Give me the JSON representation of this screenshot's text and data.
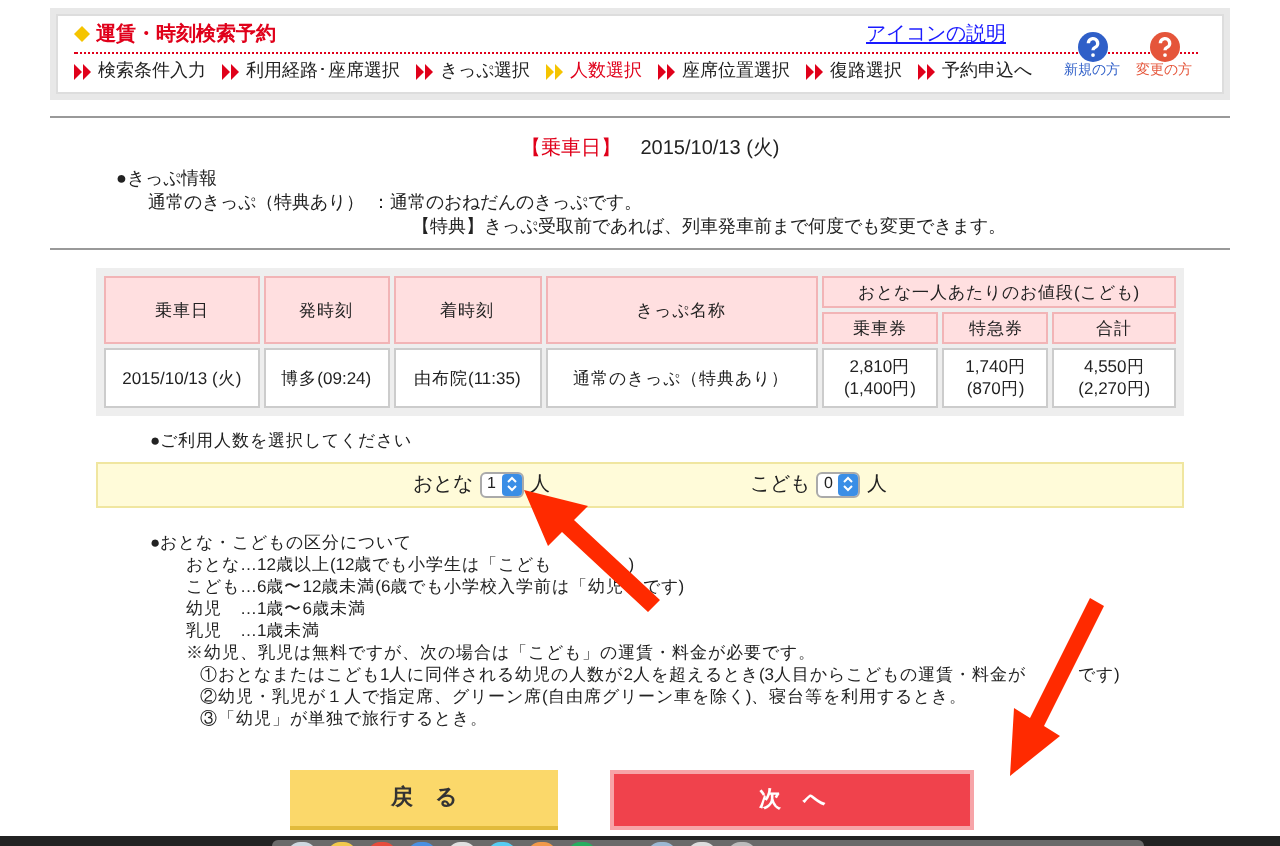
{
  "header": {
    "title": "運賃・時刻検索予約",
    "help_link": "アイコンの説明",
    "help_icons": [
      {
        "label": "新規の方",
        "color": "#2f5fc8"
      },
      {
        "label": "変更の方",
        "color": "#e5553a"
      }
    ],
    "steps": [
      {
        "label": "検索条件入力",
        "selected": false
      },
      {
        "label": "利用経路･座席選択",
        "selected": false
      },
      {
        "label": "きっぷ選択",
        "selected": false
      },
      {
        "label": "人数選択",
        "selected": true
      },
      {
        "label": "座席位置選択",
        "selected": false
      },
      {
        "label": "復路選択",
        "selected": false
      },
      {
        "label": "予約申込へ",
        "selected": false
      }
    ]
  },
  "ride_date": {
    "label": "【乗車日】",
    "value": "2015/10/13 (火)"
  },
  "ticket_info": {
    "heading": "●きっぷ情報",
    "name": "通常のきっぷ（特典あり）",
    "separator": "：",
    "description": "通常のおねだんのきっぷです。",
    "note": "【特典】きっぷ受取前であれば、列車発車前まで何度でも変更できます。"
  },
  "table": {
    "columns": [
      "乗車日",
      "発時刻",
      "着時刻",
      "きっぷ名称"
    ],
    "price_group": "おとな一人あたりのお値段(こども)",
    "price_columns": [
      "乗車券",
      "特急券",
      "合計"
    ],
    "rows": [
      {
        "cells": [
          "2015/10/13 (火)",
          "博多(09:24)",
          "由布院(11:35)",
          "通常のきっぷ（特典あり）"
        ],
        "prices": [
          [
            "2,810円",
            "(1,400円)"
          ],
          [
            "1,740円",
            "(870円)"
          ],
          [
            "4,550円",
            "(2,270円)"
          ]
        ]
      }
    ]
  },
  "count_prompt": "●ご利用人数を選択してください",
  "counts": [
    {
      "label": "おとな",
      "value": "1",
      "unit": "人"
    },
    {
      "label": "こども",
      "value": "0",
      "unit": "人"
    }
  ],
  "categories": {
    "heading": "●おとな・こどもの区分について",
    "lines": [
      [
        "おとな…12歳以上(12歳でも小学生は「こども",
        ")"
      ],
      [
        "こども…6歳〜12歳未満(6歳でも小学校入学前は「幼児",
        "です)"
      ],
      [
        "幼児　…1歳〜6歳未満"
      ],
      [
        "乳児　…1歳未満"
      ],
      [
        "※幼児、乳児は無料ですが、次の場合は「こども」の運賃・料金が必要です。"
      ]
    ],
    "sub_lines": [
      [
        "①おとなまたはこども1人に同伴される幼児の人数が2人を超えるとき(3人目からこどもの運賃・料金が",
        "です)"
      ],
      [
        "②幼児・乳児が１人で指定席、グリーン席(自由席グリーン車を除く)、寝台等を利用するとき。"
      ],
      [
        "③「幼児」が単独で旅行するとき。"
      ]
    ]
  },
  "buttons": [
    {
      "label": "戻　る",
      "kind": "back"
    },
    {
      "label": "次　へ",
      "kind": "next"
    }
  ]
}
